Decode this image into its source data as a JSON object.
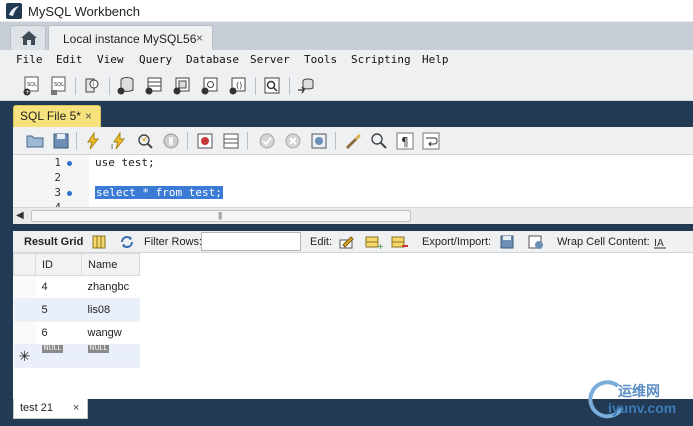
{
  "app": {
    "title": "MySQL Workbench"
  },
  "connection_tab": {
    "label": "Local instance MySQL56",
    "close": "×"
  },
  "menu": [
    "File",
    "Edit",
    "View",
    "Query",
    "Database",
    "Server",
    "Tools",
    "Scripting",
    "Help"
  ],
  "sql_tab": {
    "label": "SQL File 5*",
    "close": "×"
  },
  "editor": {
    "lines": [
      {
        "num": "1",
        "code": "use test;",
        "marker": true,
        "selected": false
      },
      {
        "num": "2",
        "code": "",
        "marker": false,
        "selected": false
      },
      {
        "num": "3",
        "code": "select * from test;",
        "marker": true,
        "selected": true
      },
      {
        "num": "4",
        "code": "",
        "marker": false,
        "selected": false
      }
    ]
  },
  "result_toolbar": {
    "result_grid": "Result Grid",
    "filter_rows": "Filter Rows:",
    "filter_value": "",
    "edit": "Edit:",
    "export_import": "Export/Import:",
    "wrap_cell": "Wrap Cell Content:"
  },
  "grid": {
    "columns": [
      "ID",
      "Name"
    ],
    "rows": [
      [
        "4",
        "zhangbc"
      ],
      [
        "5",
        "lis08"
      ],
      [
        "6",
        "wangw"
      ]
    ],
    "new_row_marker": "✳",
    "null_label": "NULL"
  },
  "result_tab": {
    "label": "test 21",
    "close": "×"
  },
  "watermark": {
    "cn": "运维网",
    "url": "iyunv.com"
  },
  "colors": {
    "frame": "#233a55",
    "sql_tab": "#f7e27d",
    "selection": "#3b7bd6",
    "chrome": "#eef0f2"
  }
}
